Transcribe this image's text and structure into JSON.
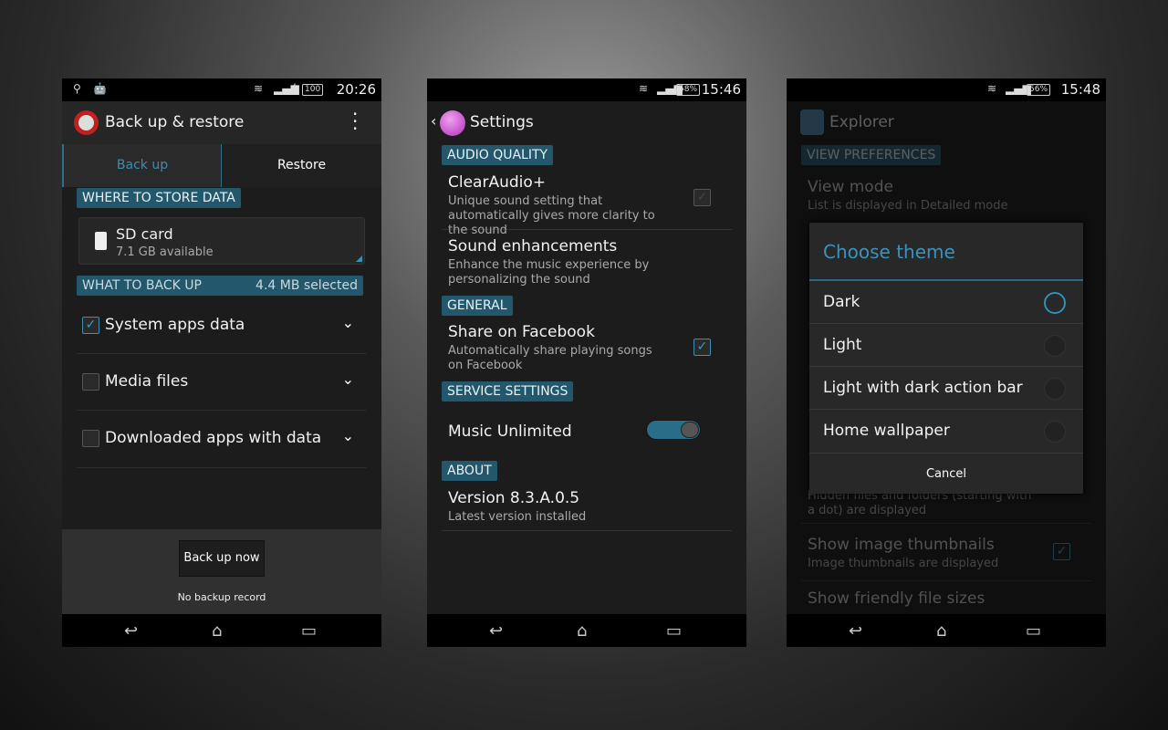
{
  "phone1": {
    "status": {
      "time": "20:26",
      "battery": "100"
    },
    "title": "Back up & restore",
    "tabs": [
      {
        "label": "Back up",
        "active": true
      },
      {
        "label": "Restore",
        "active": false
      }
    ],
    "store_header": "WHERE TO STORE DATA",
    "storage": {
      "name": "SD card",
      "available": "7.1 GB available"
    },
    "backup_header": "WHAT TO BACK UP",
    "selected": "4.4 MB selected",
    "items": [
      {
        "label": "System apps data",
        "checked": true
      },
      {
        "label": "Media files",
        "checked": false
      },
      {
        "label": "Downloaded apps with data",
        "checked": false
      }
    ],
    "button": "Back up now",
    "record": "No backup record"
  },
  "phone2": {
    "status": {
      "time": "15:46",
      "battery": "58%"
    },
    "title": "Settings",
    "audio_header": "AUDIO QUALITY",
    "clearaudio": {
      "title": "ClearAudio+",
      "sub": "Unique sound setting that automatically gives more clarity to the sound",
      "checked": false
    },
    "sound": {
      "title": "Sound enhancements",
      "sub": "Enhance the music experience by personalizing the sound"
    },
    "general_header": "GENERAL",
    "facebook": {
      "title": "Share on Facebook",
      "sub": "Automatically share playing songs on Facebook",
      "checked": true
    },
    "service_header": "SERVICE SETTINGS",
    "music_unlimited": {
      "title": "Music Unlimited",
      "on": true
    },
    "about_header": "ABOUT",
    "version": {
      "title": "Version 8.3.A.0.5",
      "sub": "Latest version installed"
    }
  },
  "phone3": {
    "status": {
      "time": "15:48",
      "battery": "56%"
    },
    "title": "Explorer",
    "pref_header": "VIEW PREFERENCES",
    "view_mode": {
      "title": "View mode",
      "sub": "List is displayed in Detailed mode"
    },
    "hidden": {
      "sub": "Hidden files and folders (starting with a dot) are displayed"
    },
    "thumbs": {
      "title": "Show image thumbnails",
      "sub": "Image thumbnails are displayed"
    },
    "friendly": {
      "title": "Show friendly file sizes"
    },
    "dialog": {
      "title": "Choose theme",
      "options": [
        "Dark",
        "Light",
        "Light with dark action bar",
        "Home wallpaper"
      ],
      "selected": "Dark",
      "cancel": "Cancel"
    }
  },
  "accent": "#2f8fb8"
}
